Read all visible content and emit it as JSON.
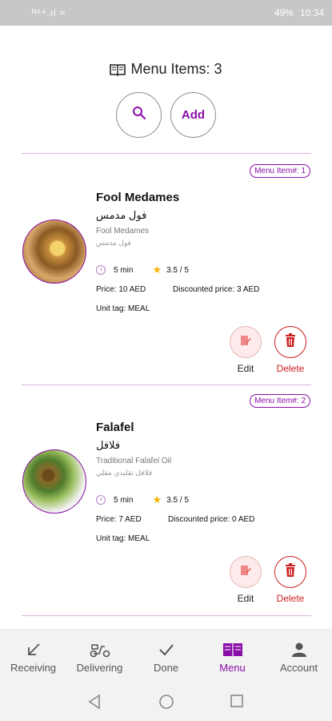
{
  "status_bar": {
    "left": "ᴺ⁶⁴.ıl ≈",
    "battery": "49%",
    "time": "10:34"
  },
  "header": {
    "title": "Menu Items: 3"
  },
  "actions": {
    "search_icon": "search-icon",
    "add_label": "Add"
  },
  "items": [
    {
      "badge": "Menu Item#: 1",
      "name": "Fool Medames",
      "name_ar": "فول مدمس",
      "desc": "Fool Medames",
      "desc_ar": "فول مدمس",
      "time": "5  min",
      "rating": "3.5 / 5",
      "price": "Price: 10  AED",
      "discounted": "Discounted price: 3  AED",
      "unit_tag": "Unit tag: MEAL",
      "edit_label": "Edit",
      "delete_label": "Delete"
    },
    {
      "badge": "Menu Item#: 2",
      "name": "Falafel",
      "name_ar": "فلافل",
      "desc": "Traditional Falafel Oil",
      "desc_ar": "فلافل تقليدي مقلي",
      "time": "5  min",
      "rating": "3.5 / 5",
      "price": "Price: 7  AED",
      "discounted": "Discounted price: 0  AED",
      "unit_tag": "Unit tag: MEAL",
      "edit_label": "Edit",
      "delete_label": "Delete"
    }
  ],
  "nav": [
    {
      "label": "Receiving",
      "icon": "arrow-down-left-icon"
    },
    {
      "label": "Delivering",
      "icon": "scooter-icon"
    },
    {
      "label": "Done",
      "icon": "check-icon"
    },
    {
      "label": "Menu",
      "icon": "book-icon",
      "active": true
    },
    {
      "label": "Account",
      "icon": "person-icon"
    }
  ],
  "colors": {
    "accent": "#8a0fa8",
    "danger": "#cc1f1f",
    "star": "#f4b400"
  }
}
